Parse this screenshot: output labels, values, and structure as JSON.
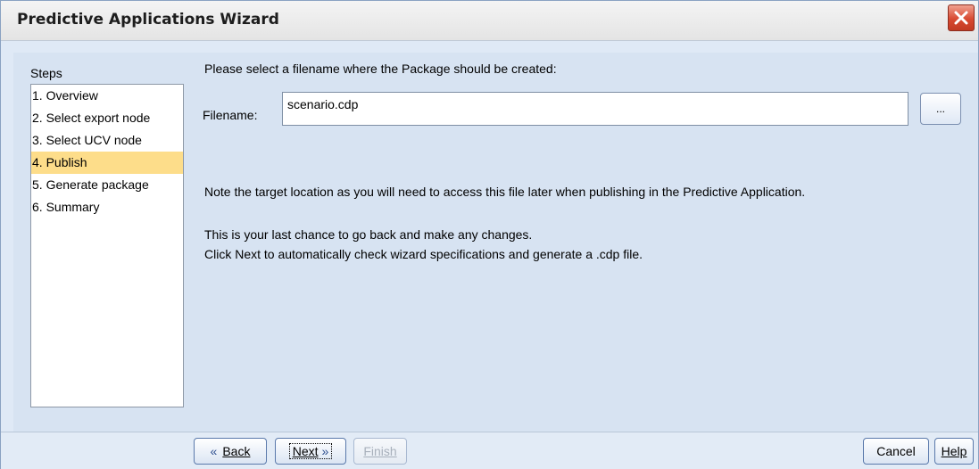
{
  "window": {
    "title": "Predictive Applications Wizard"
  },
  "steps": {
    "label": "Steps",
    "items": [
      {
        "label": "1. Overview",
        "selected": false
      },
      {
        "label": "2. Select export node",
        "selected": false
      },
      {
        "label": "3. Select UCV node",
        "selected": false
      },
      {
        "label": "4. Publish",
        "selected": true
      },
      {
        "label": "5. Generate package",
        "selected": false
      },
      {
        "label": "6. Summary",
        "selected": false
      }
    ]
  },
  "main": {
    "prompt": "Please select a filename where the Package should be created:",
    "filename_label": "Filename:",
    "filename_value": "scenario.cdp",
    "browse_label": "...",
    "note_location": "Note the target location as you will need to access this file later when publishing in the Predictive Application.",
    "note_last_chance": "This is your last chance to go back and make any changes.",
    "note_next": "Click Next to automatically check wizard specifications and generate a .cdp file."
  },
  "footer": {
    "back_label": "Back",
    "next_label": "Next",
    "finish_label": "Finish",
    "cancel_label": "Cancel",
    "help_label": "Help"
  },
  "colors": {
    "selected_step": "#fddd8a",
    "panel_background": "#d7e3f2",
    "close_button": "#d84a31"
  }
}
